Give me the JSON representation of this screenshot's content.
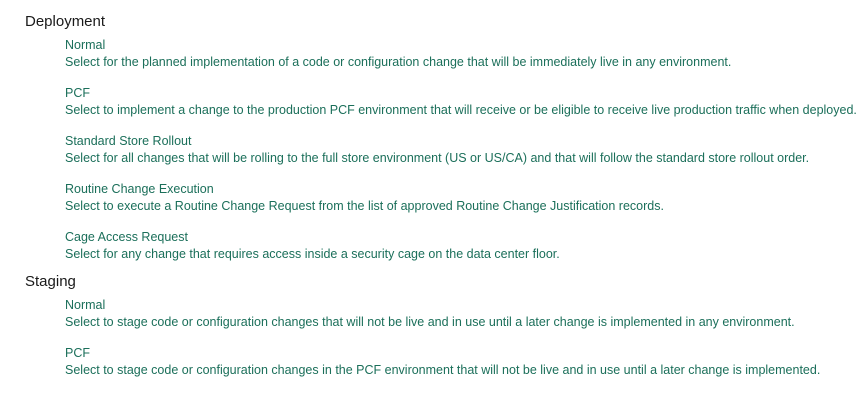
{
  "sections": [
    {
      "title": "Deployment",
      "options": [
        {
          "title": "Normal",
          "description": "Select for the planned implementation of a code or configuration change that will be immediately live in any environment."
        },
        {
          "title": "PCF",
          "description": "Select to implement a change to the production PCF environment that will receive or be eligible to receive live production traffic when deployed."
        },
        {
          "title": "Standard Store Rollout",
          "description": "Select for all changes that will be rolling to the full store environment (US or US/CA) and that will follow the standard store rollout order."
        },
        {
          "title": "Routine Change Execution",
          "description": "Select to execute a Routine Change Request from the list of approved Routine Change Justification records."
        },
        {
          "title": "Cage Access Request",
          "description": "Select for any change that requires access inside a security cage on the data center floor."
        }
      ]
    },
    {
      "title": "Staging",
      "options": [
        {
          "title": "Normal",
          "description": "Select to stage code or configuration changes that will not be live and in use until a later change is implemented in any environment."
        },
        {
          "title": "PCF",
          "description": "Select to stage code or configuration changes in the PCF environment that will not be live and in use until a later change is implemented."
        }
      ]
    }
  ],
  "colors": {
    "section_title": "#1a1a1a",
    "option_text": "#1b6f5a",
    "background": "#ffffff"
  }
}
